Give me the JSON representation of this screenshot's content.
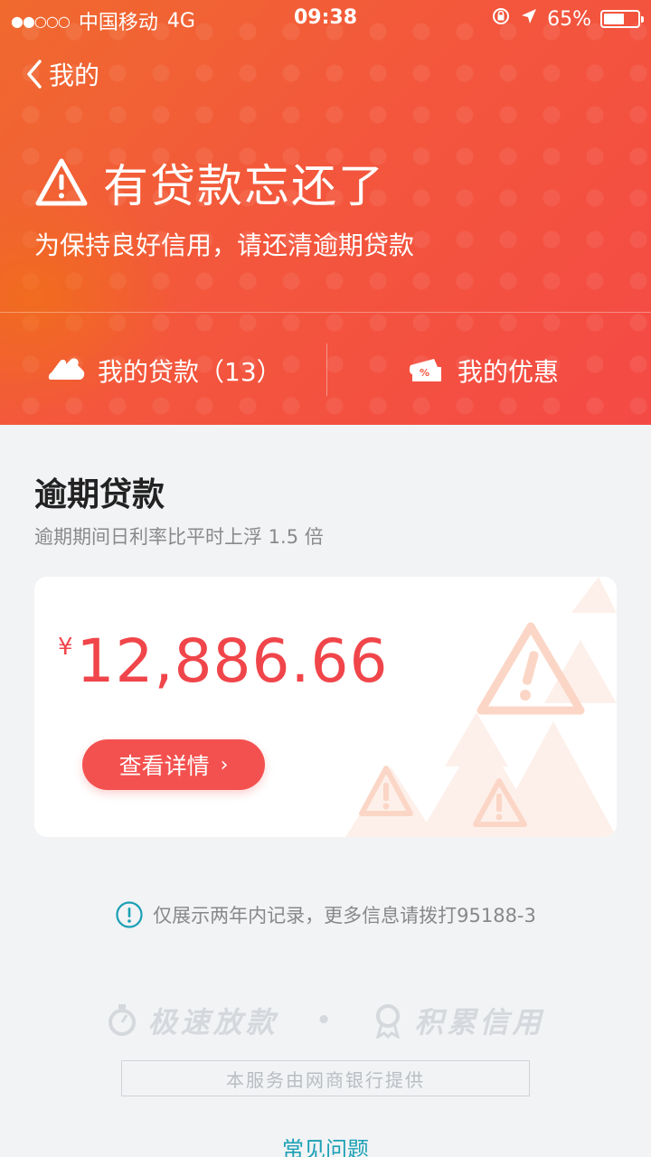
{
  "status_bar": {
    "signal": "●●○○○",
    "carrier": "中国移动",
    "network": "4G",
    "time": "09:38",
    "battery": "65%",
    "battery_level": 0.65
  },
  "nav": {
    "back_label": "我的"
  },
  "alert": {
    "title": "有贷款忘还了",
    "subtitle": "为保持良好信用，请还清逾期贷款"
  },
  "tabs": {
    "loans_label": "我的贷款（13）",
    "offers_label": "我的优惠"
  },
  "overdue": {
    "title": "逾期贷款",
    "subtitle": "逾期期间日利率比平时上浮 1.5 倍",
    "currency": "¥",
    "amount": "12,886.66",
    "detail_button": "查看详情",
    "detail_chevron": "›"
  },
  "notice": "仅展示两年内记录，更多信息请拨打95188-3",
  "slogan": {
    "left": "极速放款",
    "separator": "•",
    "right": "积累信用"
  },
  "provider": "本服务由网商银行提供",
  "faq": "常见问题",
  "colors": {
    "header_start": "#f06a2e",
    "header_end": "#f44a45",
    "accent_red": "#f0454a",
    "button_red": "#f3514f",
    "link_teal": "#1ba0b5"
  }
}
